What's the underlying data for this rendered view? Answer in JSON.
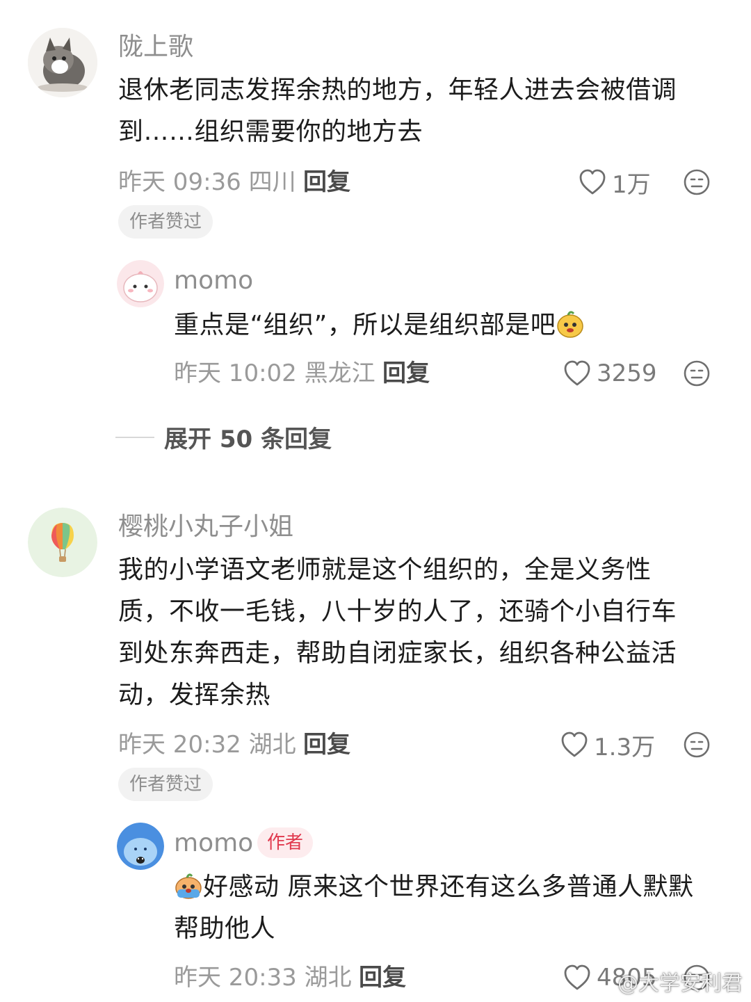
{
  "comments": [
    {
      "username": "陇上歌",
      "text": "退休老同志发挥余热的地方，年轻人进去会被借调到……组织需要你的地方去",
      "time": "昨天 09:36 四川",
      "reply_label": "回复",
      "likes": "1万",
      "badge": "作者赞过",
      "replies": [
        {
          "username": "momo",
          "text": "重点是“组织”，所以是组织部是吧",
          "time": "昨天 10:02 黑龙江",
          "reply_label": "回复",
          "likes": "3259"
        }
      ],
      "expand_label": "展开 50 条回复"
    },
    {
      "username": "樱桃小丸子小姐",
      "text_lines": [
        "我的小学语文老师就是这个组织的，全是义务性",
        "质，不收一毛钱，八十岁的人了，还骑个小自行车",
        "到处东奔西走，帮助自闭症家长，组织各种公益活",
        "动，发挥余热"
      ],
      "time": "昨天 20:32 湖北",
      "reply_label": "回复",
      "likes": "1.3万",
      "badge": "作者赞过",
      "replies": [
        {
          "username": "momo",
          "author_badge": "作者",
          "text_lines": [
            "好感动 原来这个世界还有这么多普通人默默",
            "帮助他人"
          ],
          "time": "昨天 20:33 湖北",
          "reply_label": "回复",
          "likes": "4805"
        }
      ]
    }
  ],
  "comment1_lines": [
    "退休老同志发挥余热的地方，年轻人进去会被借调",
    "到……组织需要你的地方去"
  ],
  "watermark": "@大学安利君",
  "icons": {
    "like": "heart-outline-icon",
    "dislike": "meh-face-icon"
  },
  "colors": {
    "author_badge_text": "#e0394e",
    "author_badge_bg": "#fdecee",
    "muted": "#9a9a9a"
  }
}
